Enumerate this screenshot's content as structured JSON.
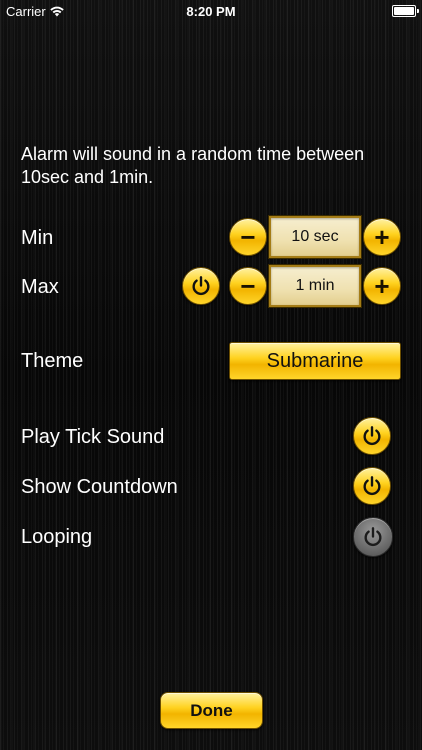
{
  "status_bar": {
    "carrier": "Carrier",
    "time": "8:20 PM",
    "icons": [
      "wifi-icon",
      "battery-icon"
    ]
  },
  "settings": {
    "description": "Alarm will sound in a random time between 10sec and 1min.",
    "min": {
      "label": "Min",
      "value": "10 sec",
      "minus_label": "−",
      "plus_label": "+"
    },
    "max": {
      "label": "Max",
      "toggle_state": "on",
      "value": "1 min",
      "minus_label": "−",
      "plus_label": "+"
    },
    "theme": {
      "label": "Theme",
      "value": "Submarine"
    },
    "toggles": [
      {
        "label": "Play Tick Sound",
        "state": "on"
      },
      {
        "label": "Show Countdown",
        "state": "on"
      },
      {
        "label": "Looping",
        "state": "off"
      }
    ],
    "done_label": "Done"
  },
  "colors": {
    "accent_yellow": "#ffd21f",
    "button_border": "#6b4e00",
    "value_field": "#efe1b0",
    "toggle_off": "#6e6e6e",
    "background": "#0b0b0b",
    "text": "#ffffff"
  }
}
